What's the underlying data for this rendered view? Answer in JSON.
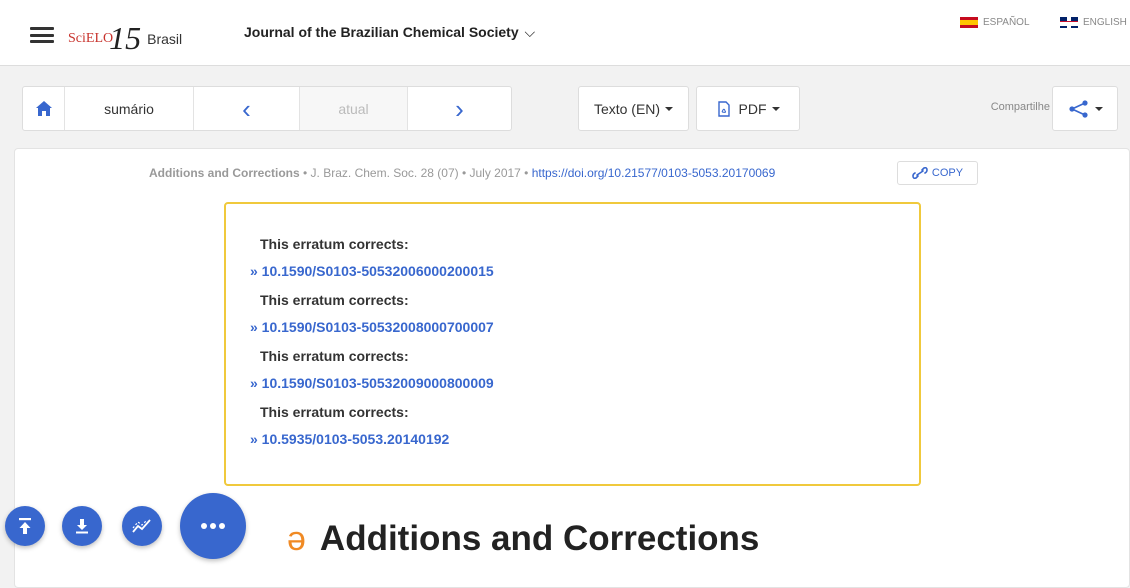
{
  "header": {
    "logo_scielo": "SciELO",
    "logo_15": "15",
    "logo_country": "Brasil",
    "journal_title": "Journal of the Brazilian Chemical Society",
    "languages": [
      {
        "label": "ESPAÑOL",
        "flag": "spain-flag"
      },
      {
        "label": "ENGLISH",
        "flag": "uk-flag"
      }
    ]
  },
  "toolbar": {
    "summary_label": "sumário",
    "current_label": "atual",
    "text_label": "Texto (EN)",
    "pdf_label": "PDF",
    "share_label": "Compartilhe"
  },
  "article": {
    "section": "Additions and Corrections",
    "meta": " • J. Braz. Chem. Soc. 28 (07) • July 2017 • ",
    "doi_url": "https://doi.org/10.21577/0103-5053.20170069",
    "copy_label": "COPY",
    "title": "Additions and Corrections"
  },
  "errata": [
    {
      "label": "This erratum corrects:",
      "link": "» 10.1590/S0103-50532006000200015"
    },
    {
      "label": "This erratum corrects:",
      "link": "» 10.1590/S0103-50532008000700007"
    },
    {
      "label": "This erratum corrects:",
      "link": "» 10.1590/S0103-50532009000800009"
    },
    {
      "label": "This erratum corrects:",
      "link": "» 10.5935/0103-5053.20140192"
    }
  ],
  "colors": {
    "accent": "#3867ce",
    "errata_border": "#f0c93c",
    "open_access": "#f08a24"
  }
}
